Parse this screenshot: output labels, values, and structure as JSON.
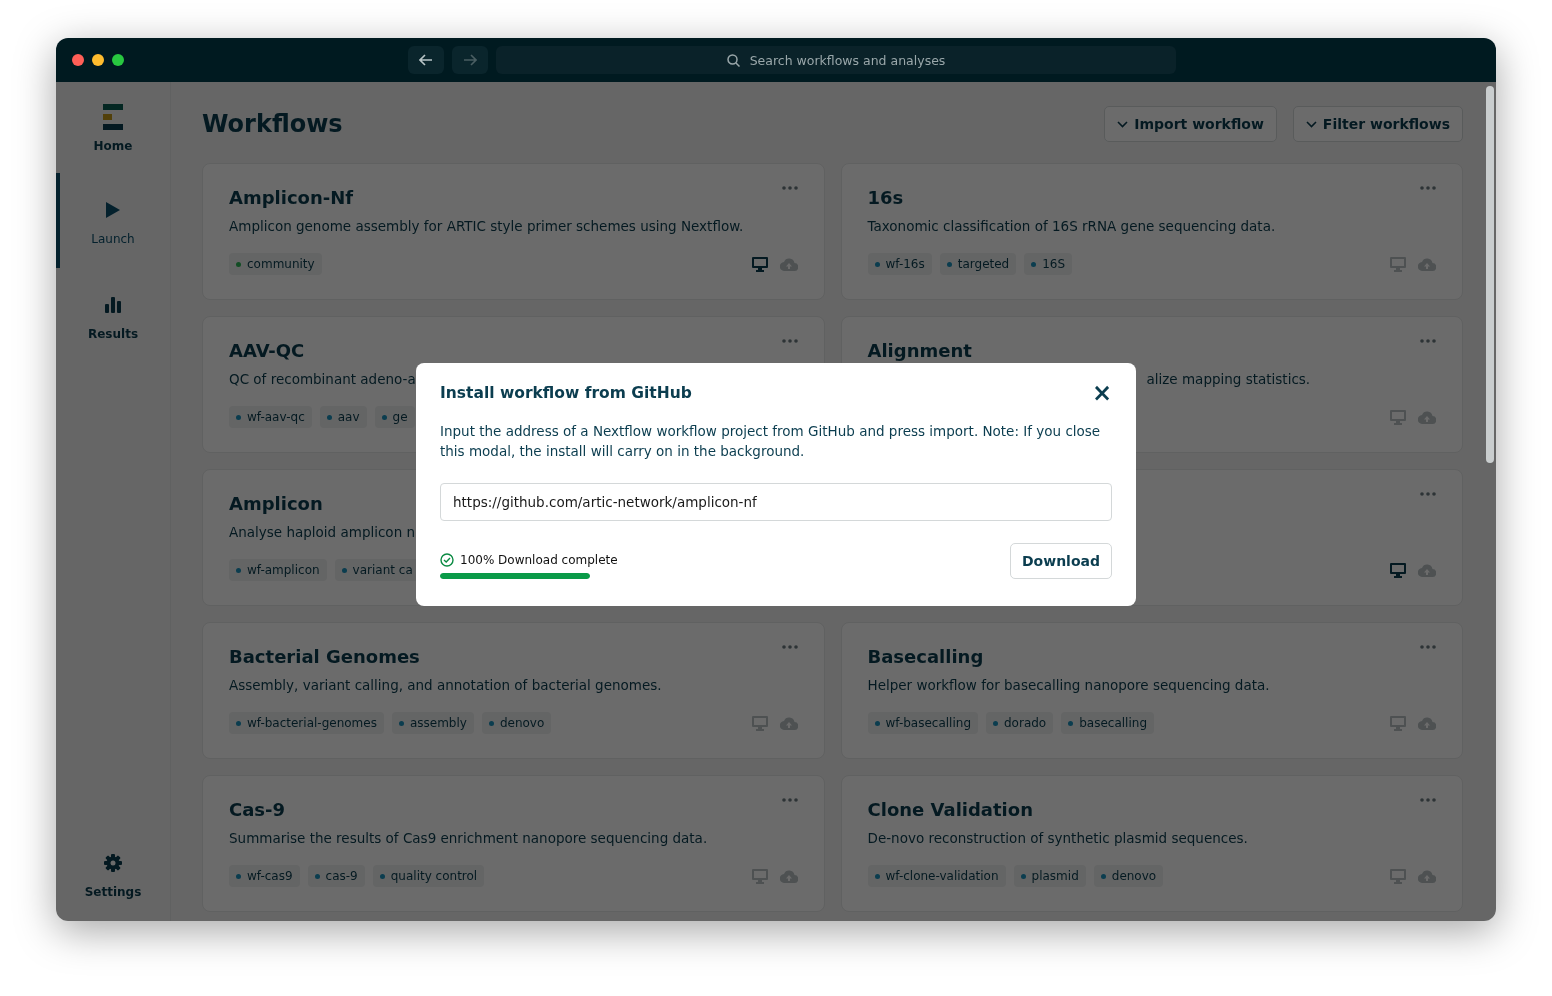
{
  "window": {
    "search_placeholder": "Search workflows and analyses"
  },
  "sidebar": {
    "items": [
      {
        "label": "Home",
        "selected": false
      },
      {
        "label": "Launch",
        "selected": true
      },
      {
        "label": "Results",
        "selected": false
      }
    ],
    "footer": {
      "label": "Settings"
    }
  },
  "page": {
    "title": "Workflows",
    "actions": [
      "Import workflow",
      "Filter workflows"
    ]
  },
  "cards": [
    {
      "title": "Amplicon-Nf",
      "description": "Amplicon genome assembly for ARTIC style primer schemes using Nextflow.",
      "desktop": true,
      "tags": [
        {
          "label": "community",
          "color": "#124d24"
        }
      ]
    },
    {
      "title": "16s",
      "description": "Taxonomic classification of 16S rRNA gene sequencing data.",
      "desktop": false,
      "tags": [
        {
          "label": "wf-16s",
          "color": "#0b3d4f"
        },
        {
          "label": "targeted",
          "color": "#0b3d4f"
        },
        {
          "label": "16S",
          "color": "#0b3d4f"
        }
      ]
    },
    {
      "title": "AAV-QC",
      "description": "QC of recombinant adeno-a",
      "tags": [
        {
          "label": "wf-aav-qc",
          "color": "#0b3d4f"
        },
        {
          "label": "aav",
          "color": "#0b3d4f"
        },
        {
          "label": "ge",
          "color": "#0b3d4f"
        }
      ]
    },
    {
      "title": "Alignment",
      "description": "alize mapping statistics.",
      "desktop": false
    },
    {
      "title": "Amplicon",
      "description": "Analyse haploid amplicon n",
      "tags": [
        {
          "label": "wf-amplicon",
          "color": "#0b3d4f"
        },
        {
          "label": "variant ca",
          "color": "#0b3d4f"
        }
      ]
    },
    {
      "desktop": true
    },
    {
      "title": "Bacterial Genomes",
      "description": "Assembly, variant calling, and annotation of bacterial genomes.",
      "desktop": false,
      "tags": [
        {
          "label": "wf-bacterial-genomes",
          "color": "#0b3d4f"
        },
        {
          "label": "assembly",
          "color": "#0b3d4f"
        },
        {
          "label": "denovo",
          "color": "#0b3d4f"
        }
      ]
    },
    {
      "title": "Basecalling",
      "description": "Helper workflow for basecalling nanopore sequencing data.",
      "desktop": false,
      "tags": [
        {
          "label": "wf-basecalling",
          "color": "#0b3d4f"
        },
        {
          "label": "dorado",
          "color": "#0b3d4f"
        },
        {
          "label": "basecalling",
          "color": "#0b3d4f"
        }
      ]
    },
    {
      "title": "Cas-9",
      "description": "Summarise the results of Cas9 enrichment nanopore sequencing data.",
      "desktop": false,
      "tags": [
        {
          "label": "wf-cas9",
          "color": "#0b3d4f"
        },
        {
          "label": "cas-9",
          "color": "#0b3d4f"
        },
        {
          "label": "quality control",
          "color": "#0b3d4f"
        }
      ]
    },
    {
      "title": "Clone Validation",
      "description": "De-novo reconstruction of synthetic plasmid sequences.",
      "desktop": false,
      "tags": [
        {
          "label": "wf-clone-validation",
          "color": "#0b3d4f"
        },
        {
          "label": "plasmid",
          "color": "#0b3d4f"
        },
        {
          "label": "denovo",
          "color": "#0b3d4f"
        }
      ]
    }
  ],
  "modal": {
    "title": "Install workflow from GitHub",
    "close": "×",
    "text": "Input the address of a Nextflow workflow project from GitHub and press import. Note: If you close this modal, the install will carry on in the background.",
    "url": "https://github.com/artic-network/amplicon-nf",
    "status": "100% Download complete",
    "level": 1,
    "button": "Download"
  }
}
